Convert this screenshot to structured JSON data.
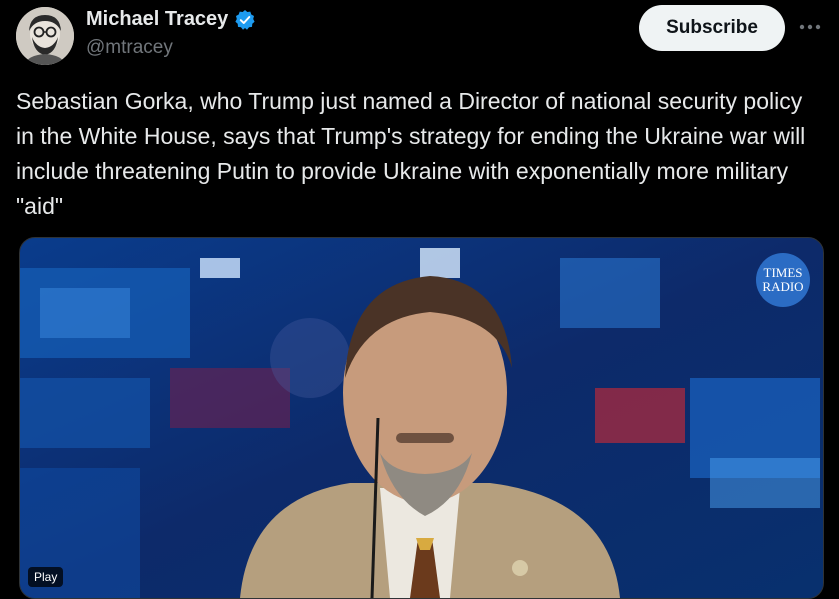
{
  "author": {
    "name": "Michael Tracey",
    "handle": "@mtracey",
    "verified_color": "#1d9bf0"
  },
  "header": {
    "subscribe_label": "Subscribe",
    "more_icon": "more-icon"
  },
  "tweet": {
    "text": "Sebastian Gorka, who Trump just named a Director of national security policy in the White House, says that Trump's strategy for ending the Ukraine war will include threatening Putin to provide Ukraine with exponentially more military \"aid\""
  },
  "media": {
    "logo_line1": "TIMES",
    "logo_line2": "RADIO",
    "play_label": "Play"
  }
}
